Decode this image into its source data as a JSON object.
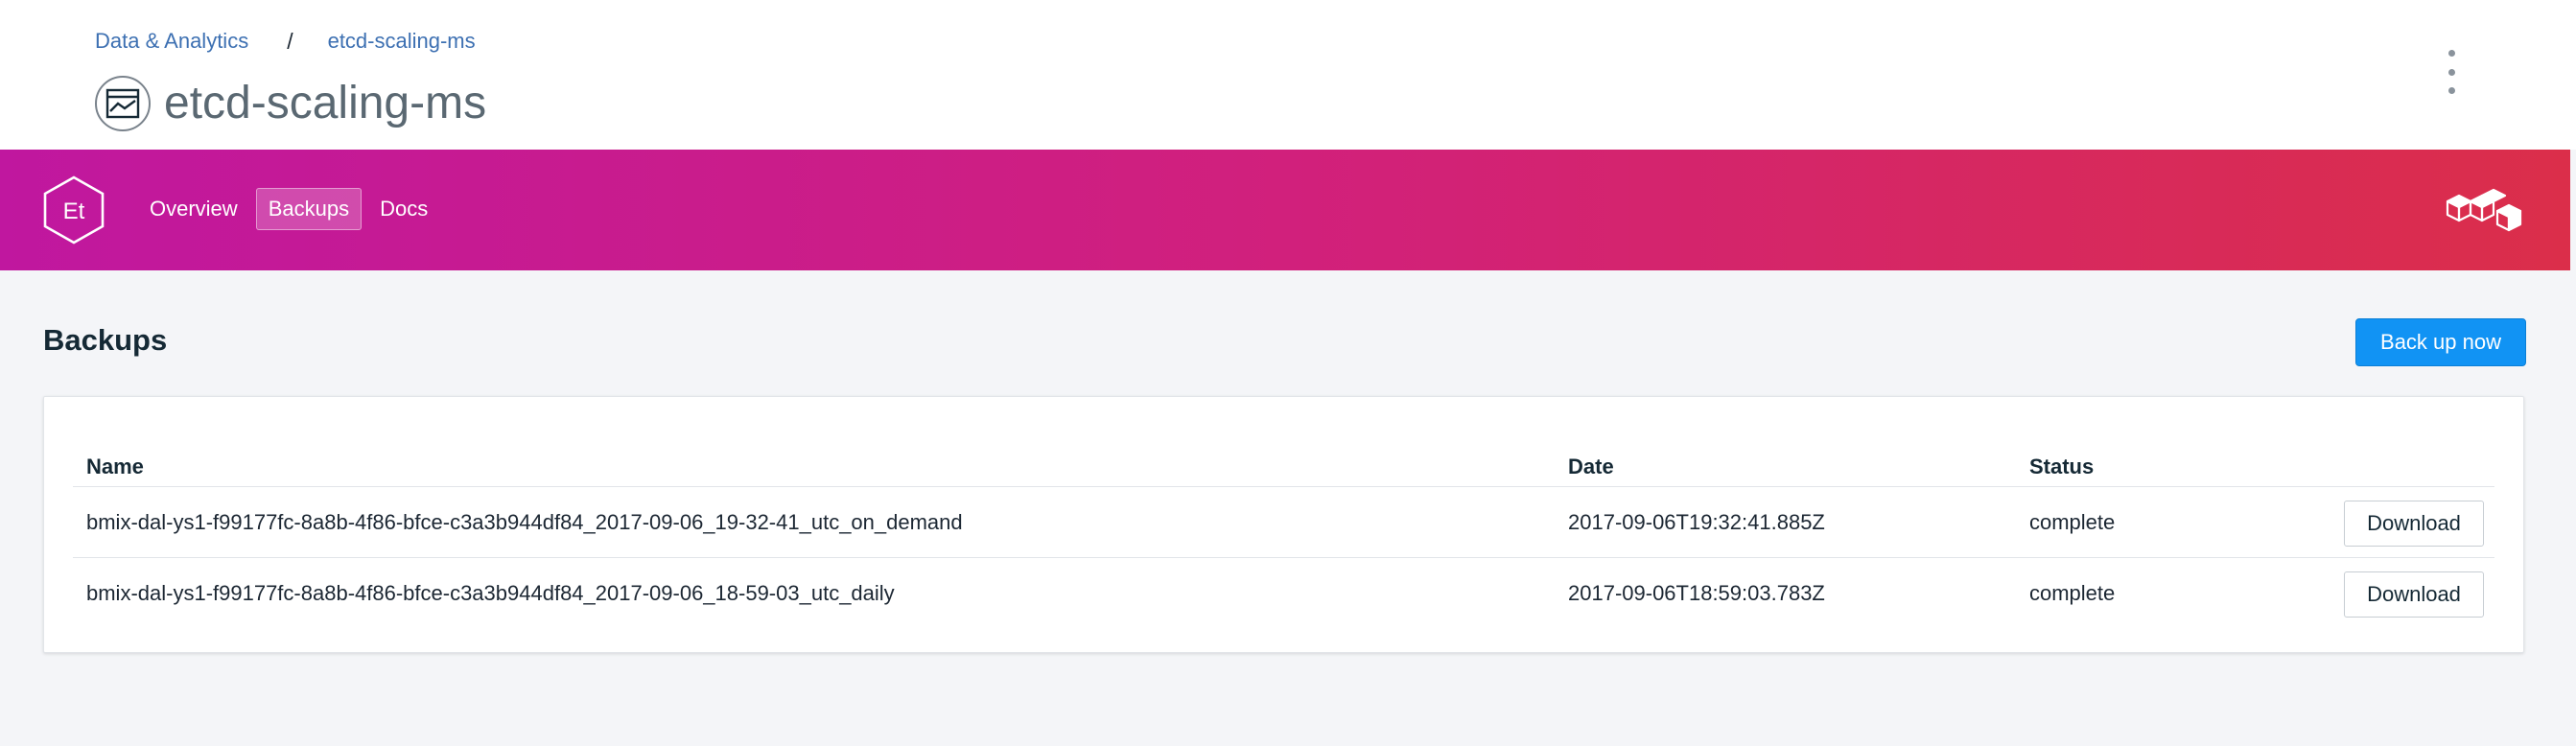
{
  "breadcrumb": {
    "parent": "Data & Analytics",
    "current": "etcd-scaling-ms",
    "separator": "/"
  },
  "header": {
    "title": "etcd-scaling-ms",
    "service_icon": "chart-window-icon",
    "menu_icon": "overflow-menu-vertical-icon"
  },
  "banner": {
    "logo_text": "Et",
    "tabs": [
      {
        "label": "Overview",
        "active": false
      },
      {
        "label": "Backups",
        "active": true
      },
      {
        "label": "Docs",
        "active": false
      }
    ],
    "right_icon": "cubes-icon",
    "gradient": [
      "#c0179f",
      "#d1207c",
      "#db2e4a"
    ]
  },
  "main": {
    "section_title": "Backups",
    "primary_button": "Back up now",
    "primary_color": "#1193f4"
  },
  "table": {
    "columns": [
      "Name",
      "Date",
      "Status"
    ],
    "rows": [
      {
        "name": "bmix-dal-ys1-f99177fc-8a8b-4f86-bfce-c3a3b944df84_2017-09-06_19-32-41_utc_on_demand",
        "date": "2017-09-06T19:32:41.885Z",
        "status": "complete",
        "action": "Download"
      },
      {
        "name": "bmix-dal-ys1-f99177fc-8a8b-4f86-bfce-c3a3b944df84_2017-09-06_18-59-03_utc_daily",
        "date": "2017-09-06T18:59:03.783Z",
        "status": "complete",
        "action": "Download"
      }
    ]
  }
}
